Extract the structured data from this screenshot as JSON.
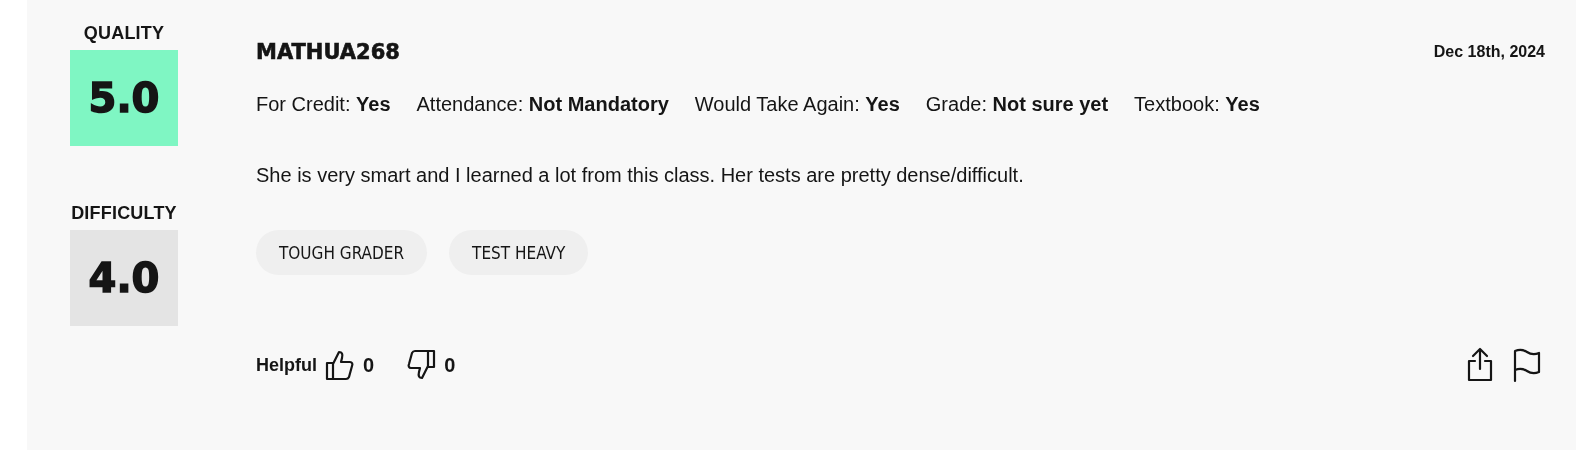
{
  "ratings": [
    {
      "label": "QUALITY",
      "value": "5.0",
      "color": "#7ff6c3"
    },
    {
      "label": "DIFFICULTY",
      "value": "4.0",
      "color": "#e4e4e4"
    }
  ],
  "review": {
    "username": "MATHUA268",
    "date": "Dec 18th, 2024",
    "meta": [
      {
        "label": "For Credit:",
        "value": "Yes"
      },
      {
        "label": "Attendance:",
        "value": "Not Mandatory"
      },
      {
        "label": "Would Take Again:",
        "value": "Yes"
      },
      {
        "label": "Grade:",
        "value": "Not sure yet"
      },
      {
        "label": "Textbook:",
        "value": "Yes"
      }
    ],
    "comment": "She is very smart and I learned a lot from this class. Her tests are pretty dense/difficult.",
    "tags": [
      "TOUGH GRADER",
      "TEST HEAVY"
    ],
    "helpful_label": "Helpful",
    "thumbs_up": "0",
    "thumbs_down": "0"
  }
}
